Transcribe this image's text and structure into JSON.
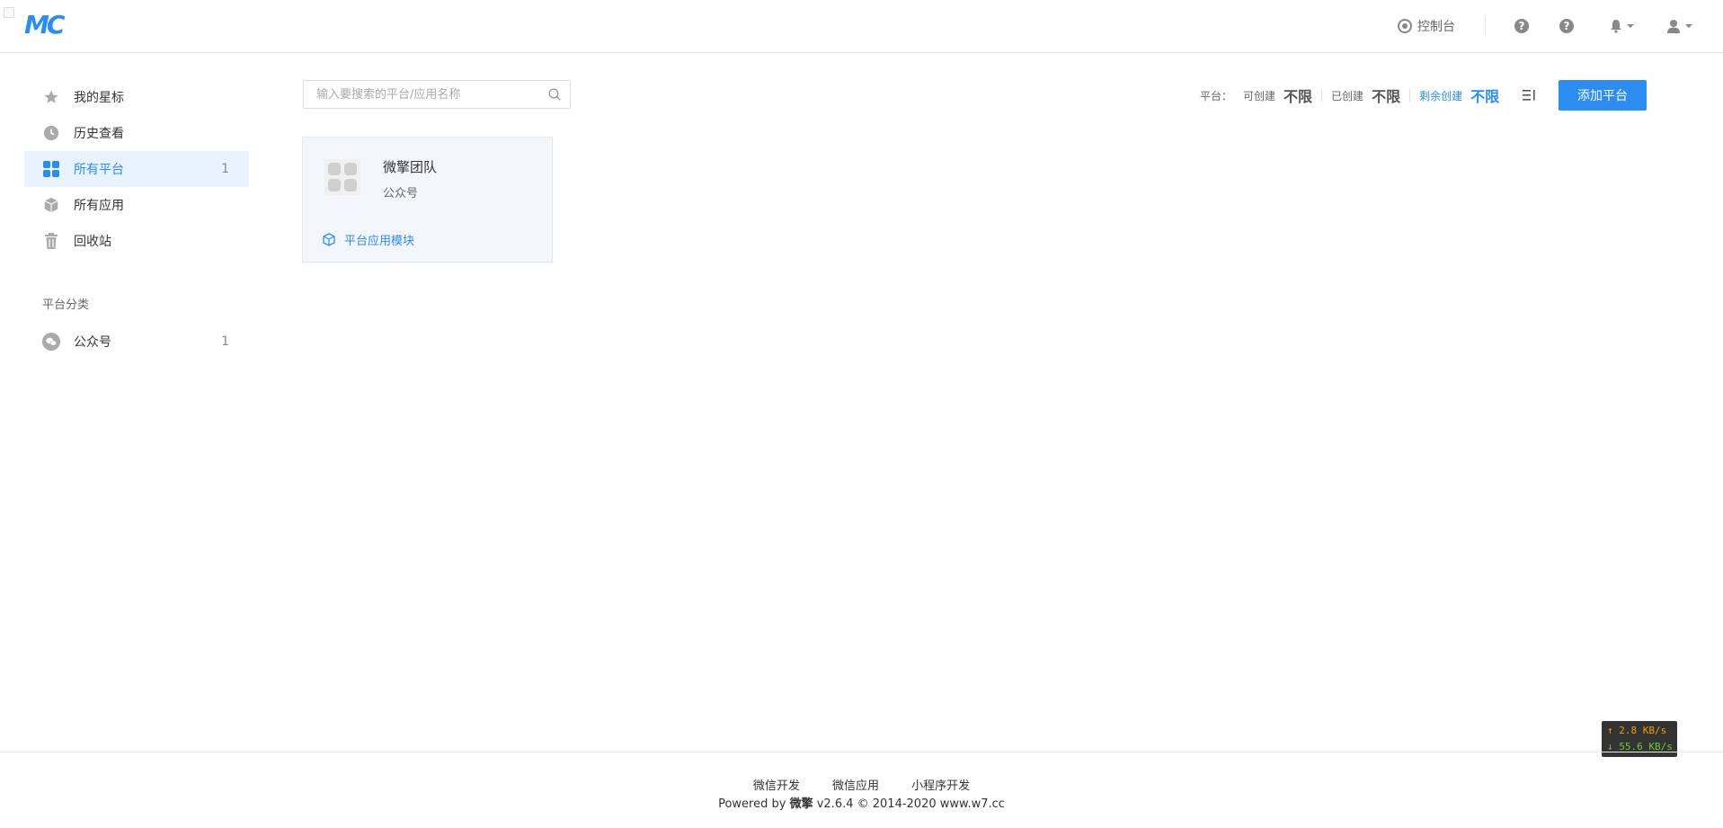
{
  "header": {
    "logo_text": "MC",
    "console_label": "控制台"
  },
  "sidebar": {
    "items": [
      {
        "label": "我的星标",
        "icon": "star-icon"
      },
      {
        "label": "历史查看",
        "icon": "clock-icon"
      },
      {
        "label": "所有平台",
        "icon": "grid-icon",
        "count": "1",
        "active": true
      },
      {
        "label": "所有应用",
        "icon": "cube-icon"
      },
      {
        "label": "回收站",
        "icon": "trash-icon"
      }
    ],
    "category_title": "平台分类",
    "categories": [
      {
        "label": "公众号",
        "icon": "wechat-icon",
        "count": "1"
      }
    ]
  },
  "search": {
    "placeholder": "输入要搜索的平台/应用名称",
    "value": ""
  },
  "stats": {
    "platform_label": "平台：",
    "can_create_label": "可创建",
    "can_create_value": "不限",
    "created_label": "已创建",
    "created_value": "不限",
    "remaining_label": "剩余创建",
    "remaining_value": "不限"
  },
  "add_button_label": "添加平台",
  "card": {
    "name": "微擎团队",
    "type": "公众号",
    "module_link": "平台应用模块"
  },
  "footer": {
    "links": [
      "微信开发",
      "微信应用",
      "小程序开发"
    ],
    "powered_prefix": "Powered by",
    "powered_brand": "微擎",
    "powered_suffix": "v2.6.4 © 2014-2020 www.w7.cc"
  },
  "net_widget": {
    "up": "↑ 2.8 KB/s",
    "down": "↓ 55.6 KB/s"
  },
  "colors": {
    "accent": "#2d8cf0",
    "active_bg": "#e8f3fe",
    "card_bg": "#f4f6fd"
  }
}
